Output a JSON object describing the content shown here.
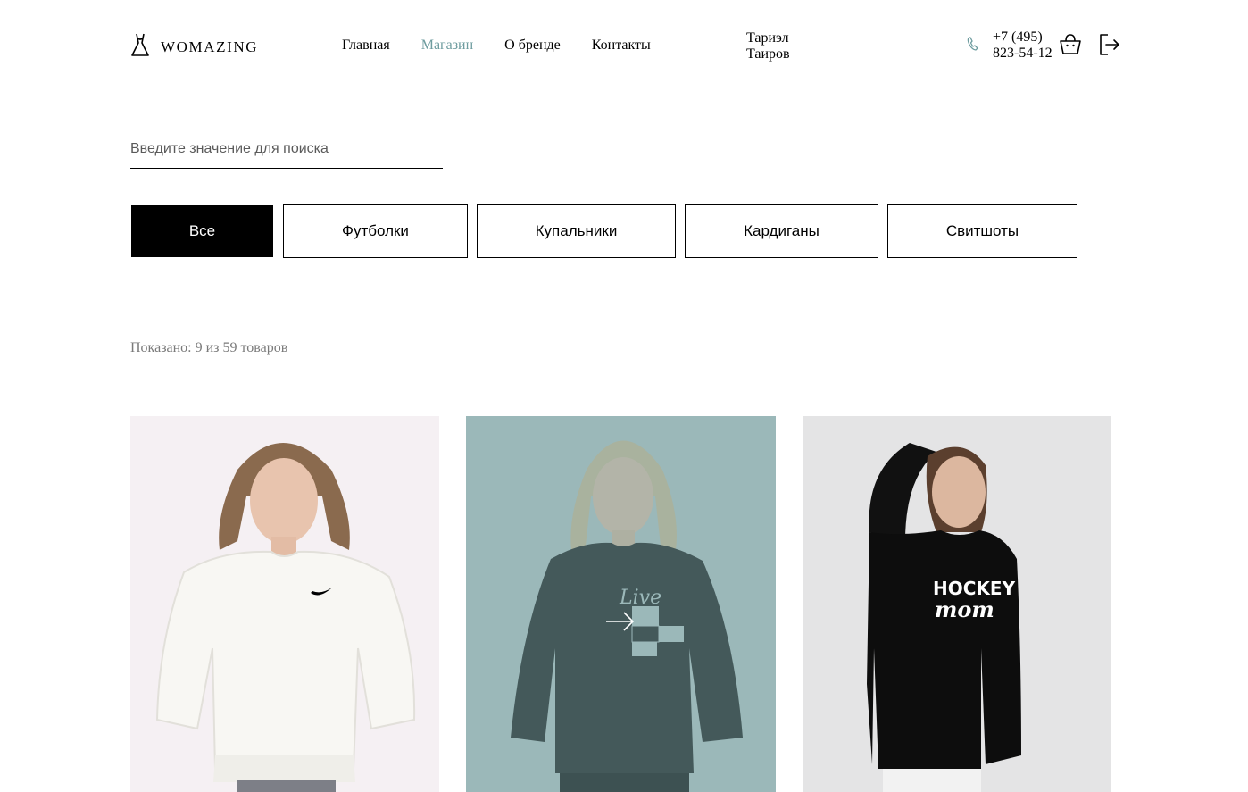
{
  "header": {
    "logo_text": "WOMAZING",
    "nav": [
      {
        "label": "Главная",
        "active": false
      },
      {
        "label": "Магазин",
        "active": true
      },
      {
        "label": "О бренде",
        "active": false
      },
      {
        "label": "Контакты",
        "active": false
      }
    ],
    "user_first": "Тариэл",
    "user_last": "Таиров",
    "phone_line1": "+7 (495)",
    "phone_line2": "823-54-12",
    "icons": [
      "dress-icon",
      "phone-icon",
      "basket-icon",
      "logout-icon"
    ]
  },
  "search": {
    "placeholder": "Введите значение для поиска",
    "value": ""
  },
  "filters": [
    {
      "label": "Все",
      "active": true
    },
    {
      "label": "Футболки",
      "active": false
    },
    {
      "label": "Купальники",
      "active": false
    },
    {
      "label": "Кардиганы",
      "active": false
    },
    {
      "label": "Свитшоты",
      "active": false
    }
  ],
  "count_text": "Показано: 9 из 59 товаров",
  "colors": {
    "accent": "#6e9c9f",
    "hover_overlay": "#9bb8b9",
    "text": "#000000",
    "muted": "#7a7a7a"
  },
  "products": [
    {
      "print": "",
      "sweater_color": "white",
      "hovered": false
    },
    {
      "print": "Live",
      "sweater_color": "dark",
      "hovered": true
    },
    {
      "print": "HOCKEY mom",
      "sweater_color": "black",
      "hovered": false
    }
  ]
}
